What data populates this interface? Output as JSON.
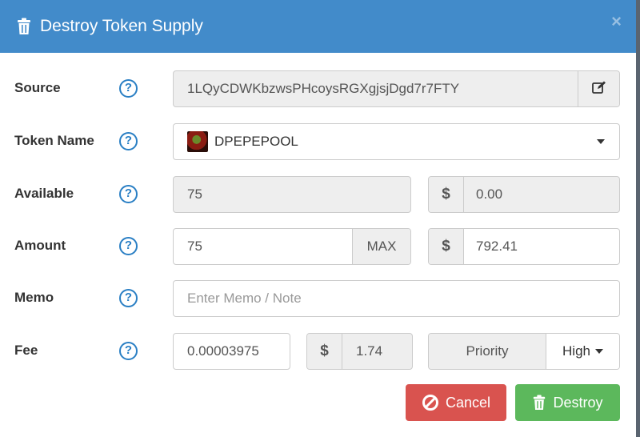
{
  "dialog": {
    "title": "Destroy Token Supply",
    "close_glyph": "×",
    "header_color": "#428bca"
  },
  "help_glyph": "?",
  "fields": {
    "source": {
      "label": "Source",
      "value": "1LQyCDWKbzwsPHcoysRGXgjsjDgd7r7FTY",
      "icon": "edit-icon"
    },
    "token_name": {
      "label": "Token Name",
      "value": "DPEPEPOOL",
      "icon": "token-image"
    },
    "available": {
      "label": "Available",
      "value": "75",
      "usd_symbol": "$",
      "usd_value": "0.00"
    },
    "amount": {
      "label": "Amount",
      "value": "75",
      "max_label": "MAX",
      "usd_symbol": "$",
      "usd_value": "792.41"
    },
    "memo": {
      "label": "Memo",
      "placeholder": "Enter Memo / Note"
    },
    "fee": {
      "label": "Fee",
      "value": "0.00003975",
      "usd_symbol": "$",
      "usd_value": "1.74",
      "priority_label": "Priority",
      "priority_value": "High"
    }
  },
  "buttons": {
    "cancel": {
      "label": "Cancel",
      "icon": "ban-icon",
      "color": "#d9534f"
    },
    "destroy": {
      "label": "Destroy",
      "icon": "trash-icon",
      "color": "#5cb85c"
    }
  }
}
